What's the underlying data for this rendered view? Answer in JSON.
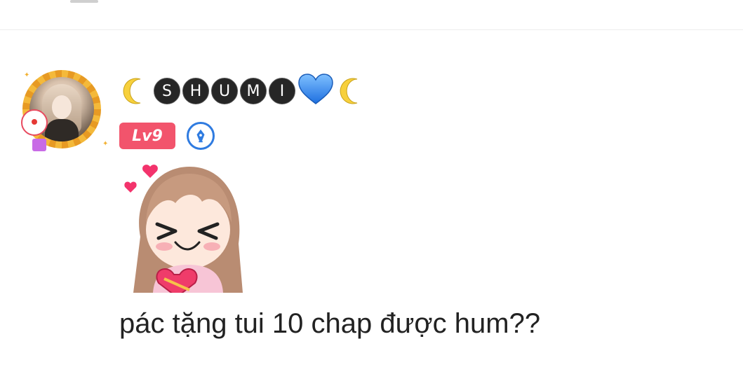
{
  "comment": {
    "username_letters": [
      "S",
      "H",
      "U",
      "M",
      "I"
    ],
    "username_decor": {
      "left": "moon-icon",
      "right": [
        "blue-heart-icon",
        "moon-icon"
      ]
    },
    "level_badge": "Lv9",
    "writer_badge": "pen-icon",
    "sticker": "chibi-girl-holding-heart-sticker",
    "text": "pác tặng tui 10 chap được hum??"
  },
  "colors": {
    "level_badge_bg": "#f2546c",
    "writer_badge_accent": "#2f7be0",
    "letter_circle_bg": "#262626",
    "moon": "#f7d03c",
    "heart": "#3e8cf0"
  }
}
